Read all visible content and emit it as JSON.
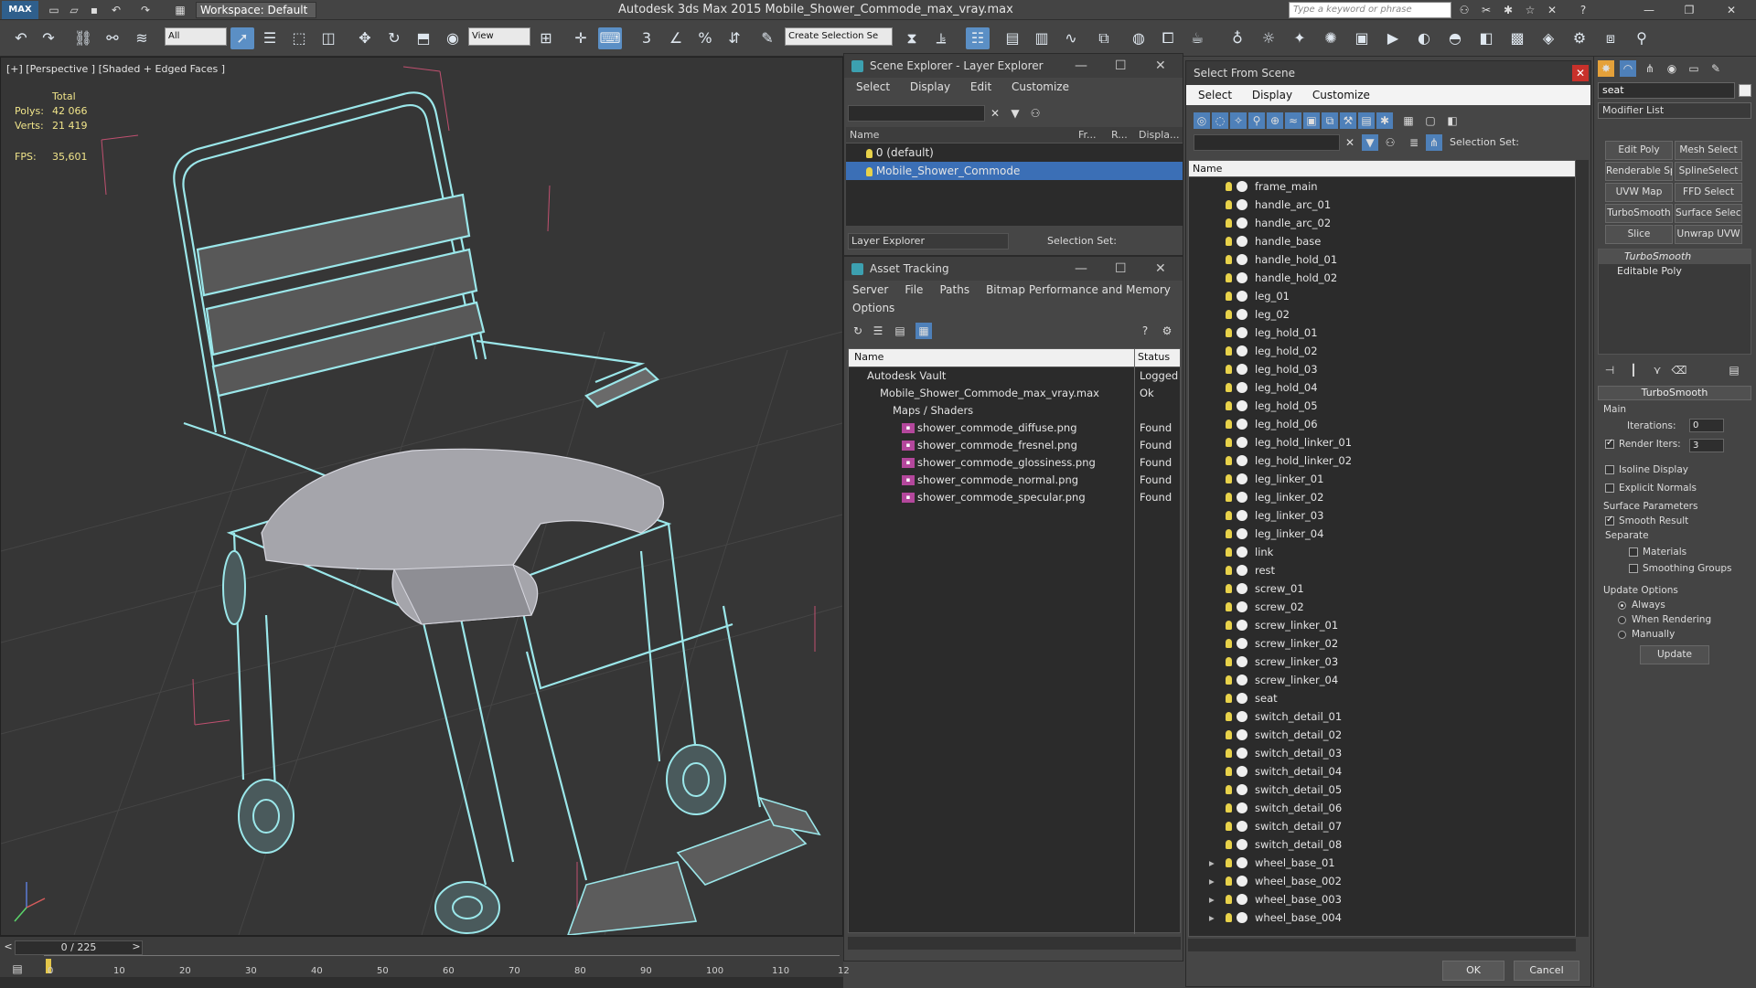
{
  "app": {
    "title": "Autodesk 3ds Max  2015      Mobile_Shower_Commode_max_vray.max",
    "workspace": "Workspace: Default",
    "search_placeholder": "Type a keyword or phrase",
    "logo": "MAX"
  },
  "toolbar": {
    "filter_select": "All",
    "view_select": "View",
    "create_selection_set": "Create Selection Se"
  },
  "viewport": {
    "label": "[+] [Perspective ] [Shaded + Edged Faces ]",
    "stats_header": "Total",
    "polys_label": "Polys:",
    "polys_value": "42 066",
    "verts_label": "Verts:",
    "verts_value": "21 419",
    "fps_label": "FPS:",
    "fps_value": "35,601"
  },
  "timeline": {
    "frame": "0 / 225",
    "ticks": [
      "0",
      "10",
      "20",
      "30",
      "40",
      "50",
      "60",
      "70",
      "80",
      "90",
      "100",
      "110",
      "12"
    ]
  },
  "scene_explorer": {
    "title": "Scene Explorer - Layer Explorer",
    "menu": [
      "Select",
      "Display",
      "Edit",
      "Customize"
    ],
    "columns": [
      "Name",
      "Fr...",
      "R...",
      "Displa..."
    ],
    "rows": [
      "0 (default)",
      "Mobile_Shower_Commode"
    ],
    "footer_dropdown": "Layer Explorer",
    "selection_set": "Selection Set:"
  },
  "asset_tracking": {
    "title": "Asset Tracking",
    "menu": [
      "Server",
      "File",
      "Paths",
      "Bitmap Performance and Memory",
      "Options"
    ],
    "columns": [
      "Name",
      "Status"
    ],
    "rows": [
      {
        "name": "Autodesk Vault",
        "status": "Logged"
      },
      {
        "name": "Mobile_Shower_Commode_max_vray.max",
        "status": "Ok"
      },
      {
        "name": "Maps / Shaders",
        "status": ""
      },
      {
        "name": "shower_commode_diffuse.png",
        "status": "Found"
      },
      {
        "name": "shower_commode_fresnel.png",
        "status": "Found"
      },
      {
        "name": "shower_commode_glossiness.png",
        "status": "Found"
      },
      {
        "name": "shower_commode_normal.png",
        "status": "Found"
      },
      {
        "name": "shower_commode_specular.png",
        "status": "Found"
      }
    ]
  },
  "select_from_scene": {
    "title": "Select From Scene",
    "menu": [
      "Select",
      "Display",
      "Customize"
    ],
    "selection_set": "Selection Set:",
    "column": "Name",
    "items": [
      "frame_main",
      "handle_arc_01",
      "handle_arc_02",
      "handle_base",
      "handle_hold_01",
      "handle_hold_02",
      "leg_01",
      "leg_02",
      "leg_hold_01",
      "leg_hold_02",
      "leg_hold_03",
      "leg_hold_04",
      "leg_hold_05",
      "leg_hold_06",
      "leg_hold_linker_01",
      "leg_hold_linker_02",
      "leg_linker_01",
      "leg_linker_02",
      "leg_linker_03",
      "leg_linker_04",
      "link",
      "rest",
      "screw_01",
      "screw_02",
      "screw_linker_01",
      "screw_linker_02",
      "screw_linker_03",
      "screw_linker_04",
      "seat",
      "switch_detail_01",
      "switch_detail_02",
      "switch_detail_03",
      "switch_detail_04",
      "switch_detail_05",
      "switch_detail_06",
      "switch_detail_07",
      "switch_detail_08",
      "wheel_base_01",
      "wheel_base_002",
      "wheel_base_003",
      "wheel_base_004"
    ],
    "ok": "OK",
    "cancel": "Cancel"
  },
  "command_panel": {
    "object_name": "seat",
    "modifier_list": "Modifier List",
    "buttons": [
      "Edit Poly",
      "Mesh Select",
      "Renderable Spline",
      "SplineSelect",
      "UVW Map",
      "FFD Select",
      "TurboSmooth",
      "Surface Select",
      "Slice",
      "Unwrap UVW"
    ],
    "stack": [
      "TurboSmooth",
      "Editable Poly"
    ],
    "rollout_title": "TurboSmooth",
    "main_label": "Main",
    "iterations_label": "Iterations:",
    "iterations_value": "0",
    "render_iters_label": "Render Iters:",
    "render_iters_value": "3",
    "isoline": "Isoline Display",
    "explicit_normals": "Explicit Normals",
    "surface_params": "Surface Parameters",
    "smooth_result": "Smooth Result",
    "separate": "Separate",
    "materials": "Materials",
    "smoothing_groups": "Smoothing Groups",
    "update_options": "Update Options",
    "always": "Always",
    "when_rendering": "When Rendering",
    "manually": "Manually",
    "update": "Update"
  }
}
